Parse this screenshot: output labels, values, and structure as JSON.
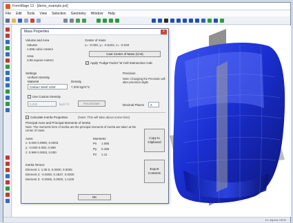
{
  "window": {
    "title": "FormMage 13 - [demo_example.pol]"
  },
  "menu": [
    "File",
    "Edit",
    "Tools",
    "View",
    "Selection",
    "Geometry",
    "Window",
    "Help"
  ],
  "dialog": {
    "title": "Mass Properties",
    "close": "×",
    "volume_area": {
      "heading": "Volume and Area",
      "volume_label": "Volume",
      "volume_value": "1.596 cubic meters",
      "area_label": "Area",
      "area_value": "3.88 square meters"
    },
    "center_of_mass": {
      "heading": "Center of mass",
      "value": "x= -0.000, y= -0.5322, z= -0.049",
      "button": "Cast Center of Mass (Cmt)",
      "checkbox_label": "Apply 'Fudge Factor' W Cell Intersection Calc",
      "checked": true
    },
    "settings": {
      "heading": "Settings",
      "density_label": "Uniform Density",
      "material_label": "Material",
      "material_value": "Carbon Steel 1020",
      "density_value_label": "Density",
      "density_value": "7,200 kg/m^3",
      "use_custom_checkbox": "Use Custom Density",
      "custom_value": "0.000",
      "custom_unit": "kg/m^3",
      "recalc_button": "Recalculate"
    },
    "precision": {
      "heading": "Precision",
      "note": "Note: Changing the Precision will alter precision digits",
      "decimal_label": "Decimal Places",
      "decimal_value": "3"
    },
    "inertia": {
      "checkbox_label": "Calculate Inertia Properties",
      "checked": true,
      "note_right": "(Note: This will take about some time)",
      "heading": "Principal Axes and Principal Moments of Inertia",
      "note": "Note: The moments here of inertia are the principal moments of inertia are taken at the center of mass",
      "axes_label": "Axes:",
      "axes": [
        "x: 0.000 0.9990, 0.0003",
        "y: -0.000 0.000, 0.999",
        "z: 0.999 0.0003, 0.000"
      ],
      "moments_label": "Moments",
      "moments": [
        {
          "name": "Px",
          "value": "1.085"
        },
        {
          "name": "Py",
          "value": "0.486"
        },
        {
          "name": "Pz",
          "value": "1.11"
        }
      ],
      "tensor_label": "Inertia Tensor:",
      "tensor": [
        "Element 1: 1.08 0, 0.0000, 0.0005",
        "Element 2: -0.0000, 0.4837, 0.0000",
        "Element 3: -0.0005, 0.0000, 1.1100"
      ],
      "copy_clipboard": "Copy to Clipboard",
      "export_button": "Export Contents"
    },
    "ok_button": "OK"
  },
  "status": {
    "text": "1/1 objects  100%"
  },
  "colors": {
    "object_blue": "#1a2fd1",
    "accent": "#2357c8"
  }
}
